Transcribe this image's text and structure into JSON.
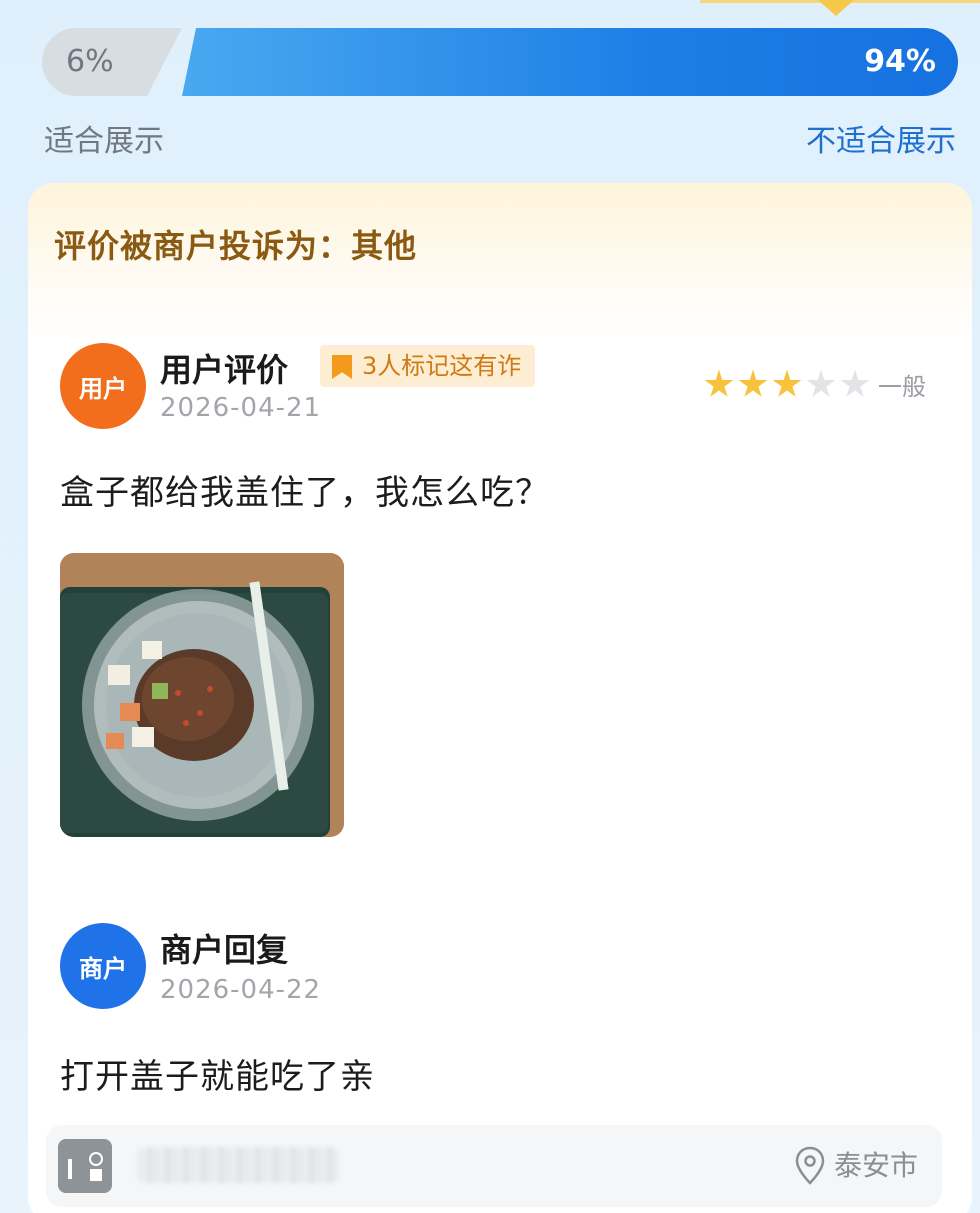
{
  "vote": {
    "suitable_percent": "6%",
    "unsuitable_percent": "94%",
    "suitable_label": "适合展示",
    "unsuitable_label": "不适合展示",
    "colors": {
      "suitable": "#d8dde2",
      "unsuitable": "#1d7fe6"
    }
  },
  "complaint": {
    "text": "评价被商户投诉为：其他"
  },
  "review": {
    "avatar": "用户",
    "title": "用户评价",
    "badge": "3人标记这有诈",
    "date": "2026-04-21",
    "rating": 3,
    "rating_max": 5,
    "rating_text": "一般",
    "text": "盒子都给我盖住了，我怎么吃？",
    "photo_icon": "food-photo"
  },
  "reply": {
    "avatar": "商户",
    "title": "商户回复",
    "date": "2026-04-22",
    "text": "打开盖子就能吃了亲"
  },
  "store": {
    "icon": "store-icon",
    "location": "泰安市"
  },
  "colors": {
    "user_avatar": "#f26d1c",
    "merchant_avatar": "#1f72e8",
    "star_on": "#f8c33a",
    "star_off": "#e2e4e7",
    "complaint_text": "#8a5a12"
  }
}
